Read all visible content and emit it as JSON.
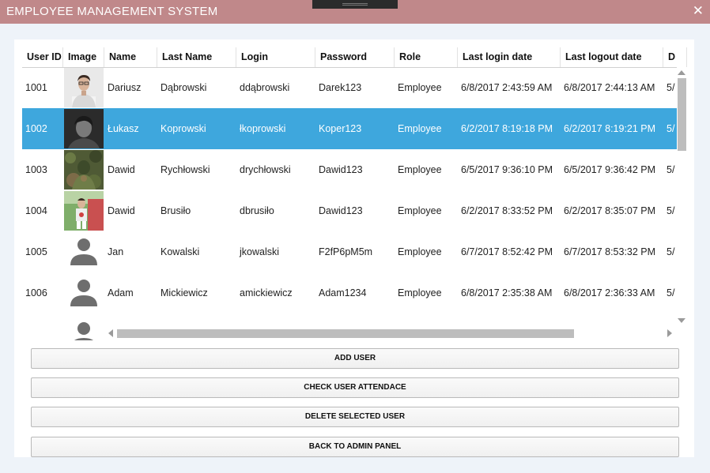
{
  "window": {
    "title": "EMPLOYEE MANAGEMENT SYSTEM",
    "close_glyph": "✕"
  },
  "grid": {
    "columns": [
      "User ID",
      "Image",
      "Name",
      "Last Name",
      "Login",
      "Password",
      "Role",
      "Last login date",
      "Last logout date",
      "D"
    ],
    "rows": [
      {
        "user_id": "1001",
        "image": "photo-portrait",
        "name": "Dariusz",
        "last_name": "Dąbrowski",
        "login": "ddąbrowski",
        "password": "Darek123",
        "role": "Employee",
        "last_login": "6/8/2017 2:43:59 AM",
        "last_logout": "6/8/2017 2:44:13 AM",
        "extra": "5/",
        "selected": false
      },
      {
        "user_id": "1002",
        "image": "photo-dark",
        "name": "Łukasz",
        "last_name": "Koprowski",
        "login": "łkoprowski",
        "password": "Koper123",
        "role": "Employee",
        "last_login": "6/2/2017 8:19:18 PM",
        "last_logout": "6/2/2017 8:19:21 PM",
        "extra": "5/",
        "selected": true
      },
      {
        "user_id": "1003",
        "image": "photo-camo",
        "name": "Dawid",
        "last_name": "Rychłowski",
        "login": "drychłowski",
        "password": "Dawid123",
        "role": "Employee",
        "last_login": "6/5/2017 9:36:10 PM",
        "last_logout": "6/5/2017 9:36:42 PM",
        "extra": "5/",
        "selected": false
      },
      {
        "user_id": "1004",
        "image": "photo-outdoor",
        "name": "Dawid",
        "last_name": "Brusiło",
        "login": "dbrusiło",
        "password": "Dawid123",
        "role": "Employee",
        "last_login": "6/2/2017 8:33:52 PM",
        "last_logout": "6/2/2017 8:35:07 PM",
        "extra": "5/",
        "selected": false
      },
      {
        "user_id": "1005",
        "image": "user-placeholder-icon",
        "name": "Jan",
        "last_name": "Kowalski",
        "login": "jkowalski",
        "password": "F2fP6pM5m",
        "role": "Employee",
        "last_login": "6/7/2017 8:52:42 PM",
        "last_logout": "6/7/2017 8:53:32 PM",
        "extra": "5/",
        "selected": false
      },
      {
        "user_id": "1006",
        "image": "user-placeholder-icon",
        "name": "Adam",
        "last_name": "Mickiewicz",
        "login": "amickiewicz",
        "password": "Adam1234",
        "role": "Employee",
        "last_login": "6/8/2017 2:35:38 AM",
        "last_logout": "6/8/2017 2:36:33 AM",
        "extra": "5/",
        "selected": false
      }
    ]
  },
  "buttons": {
    "add_user": "ADD USER",
    "check_attendance": "CHECK USER ATTENDACE",
    "delete_user": "DELETE SELECTED USER",
    "back": "BACK TO ADMIN PANEL"
  },
  "colors": {
    "titlebar": "#c0888a",
    "selection": "#3ea7dd"
  }
}
